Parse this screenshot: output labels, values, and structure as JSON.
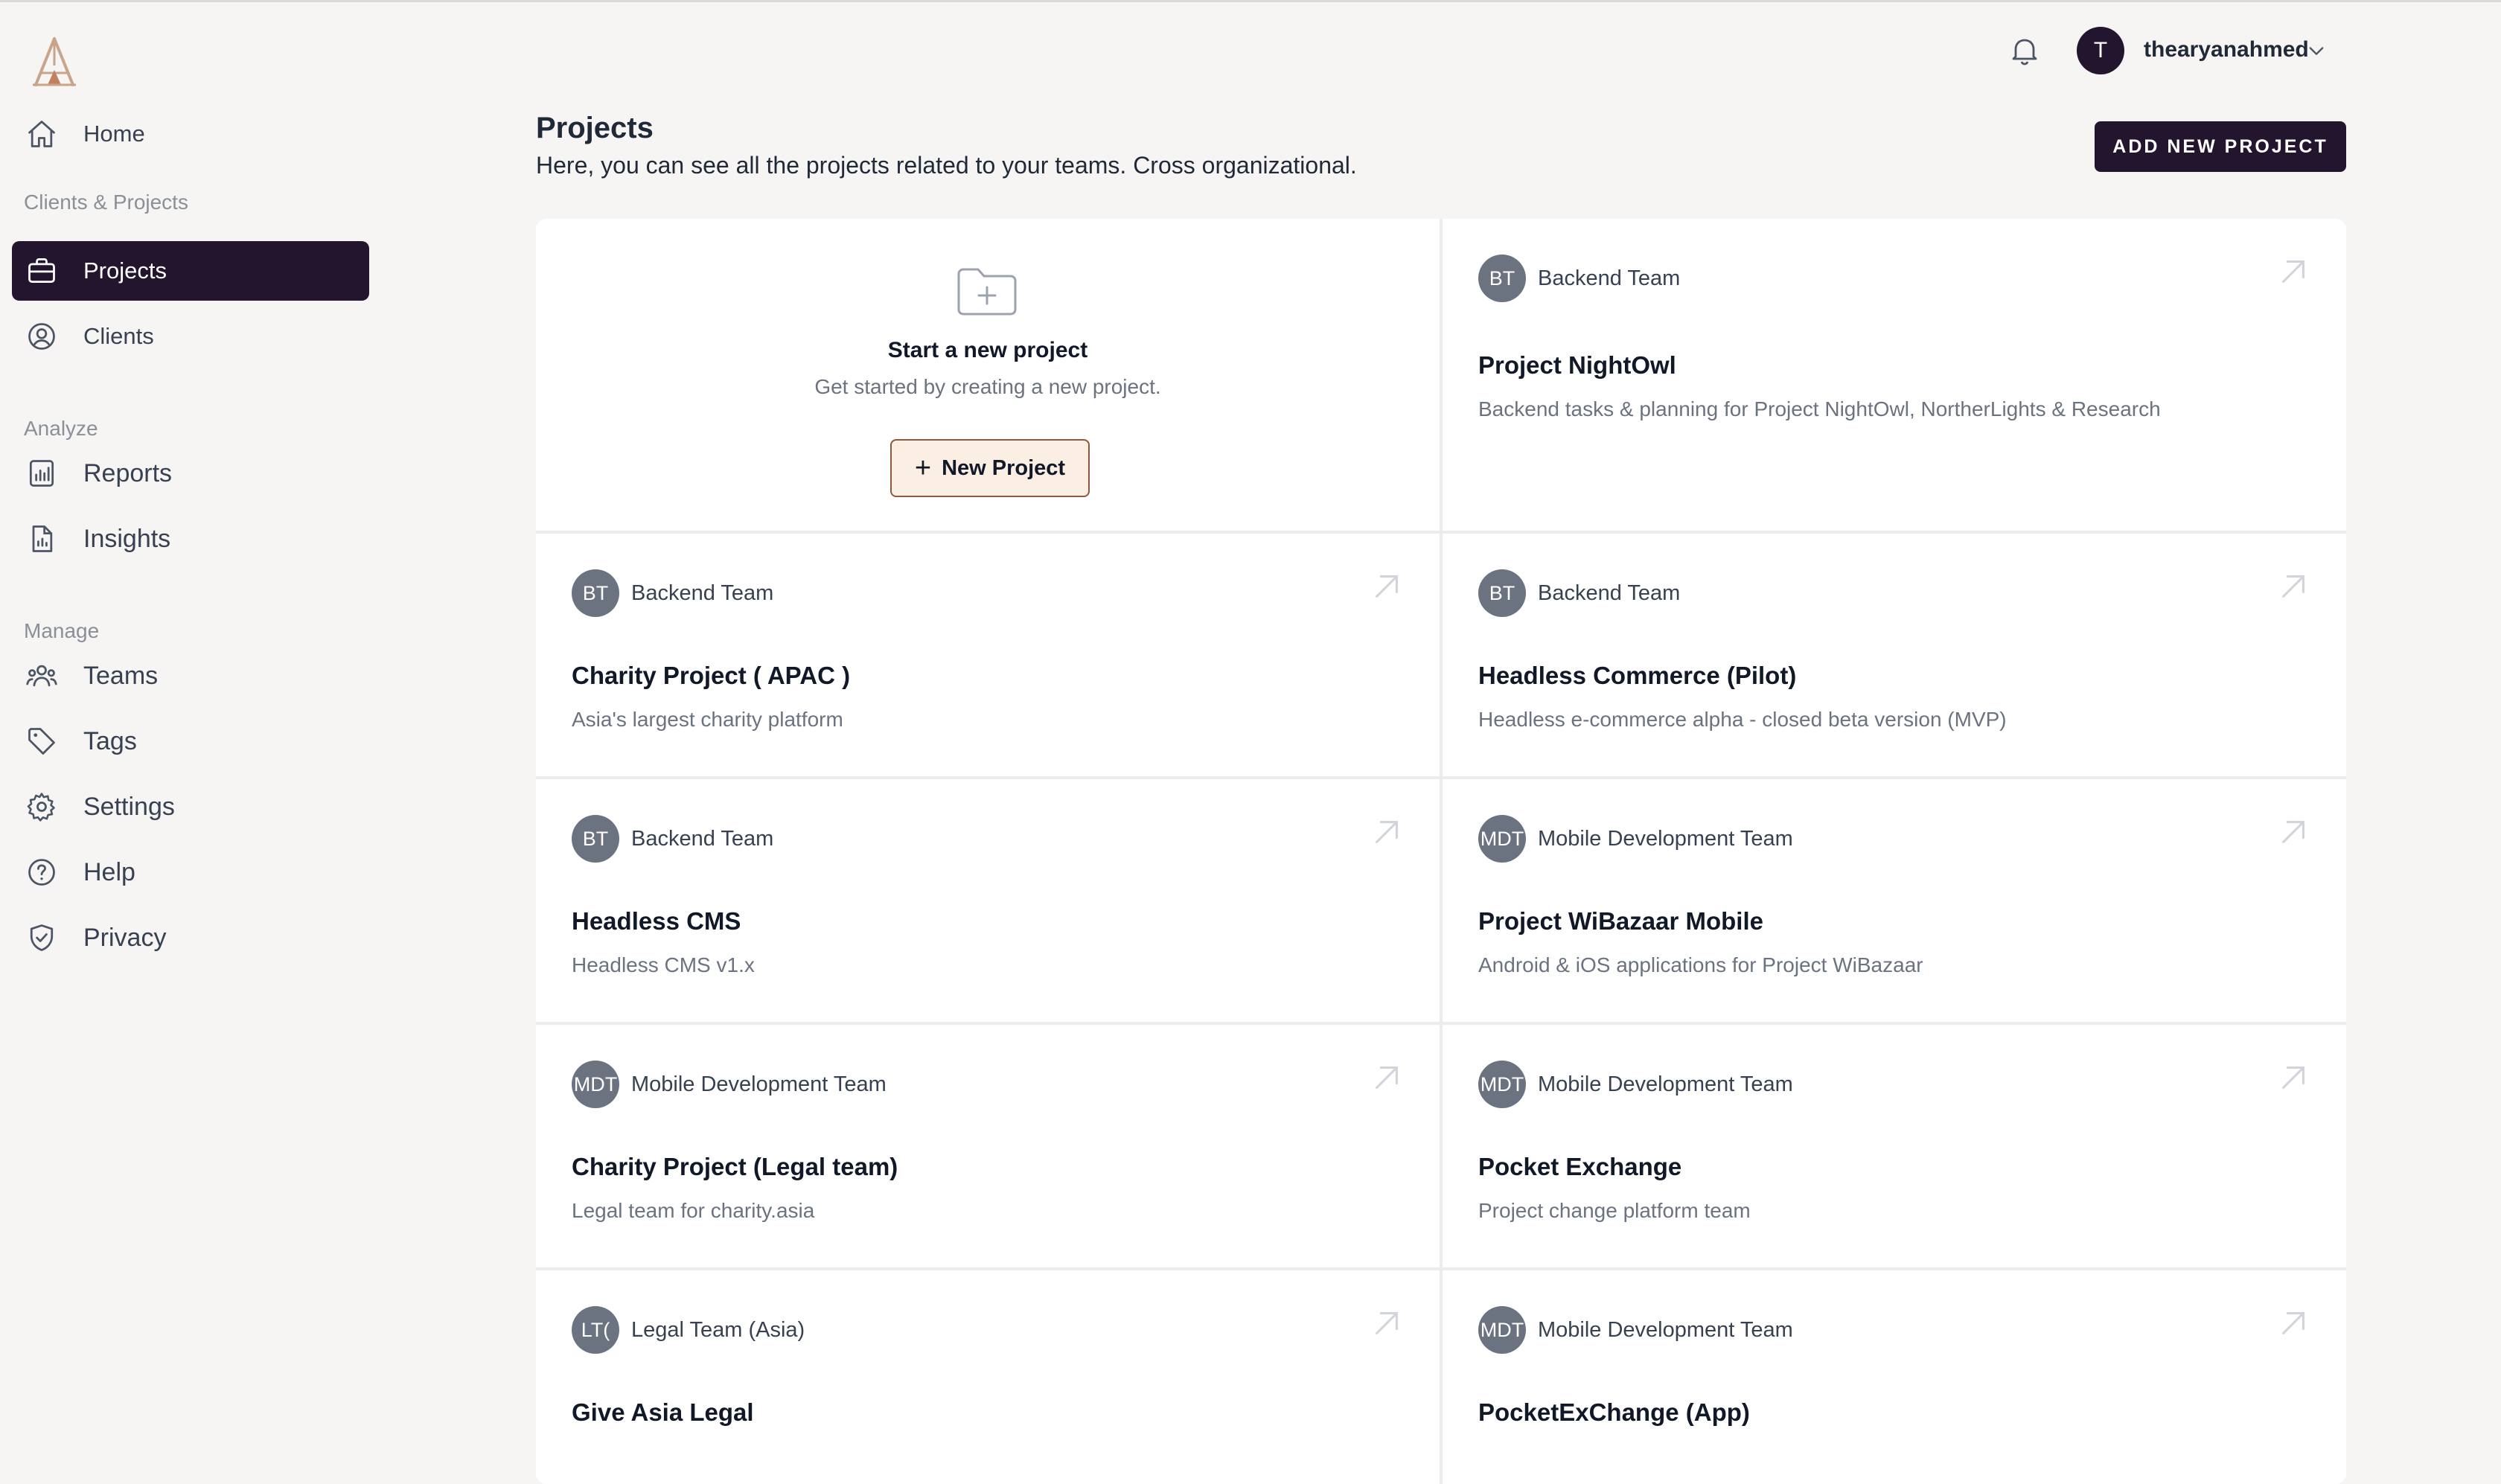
{
  "sidebar": {
    "logo": "triangle-logo",
    "home": "Home",
    "section_clients": "Clients & Projects",
    "projects": "Projects",
    "clients": "Clients",
    "section_analyze": "Analyze",
    "reports": "Reports",
    "insights": "Insights",
    "section_manage": "Manage",
    "teams": "Teams",
    "tags": "Tags",
    "settings": "Settings",
    "help": "Help",
    "privacy": "Privacy"
  },
  "header": {
    "user_initial": "T",
    "username": "thearyanahmed",
    "title": "Projects",
    "subtitle": "Here, you can see all the projects related to your teams. Cross organizational.",
    "add_button": "ADD NEW PROJECT"
  },
  "new_project": {
    "title": "Start a new project",
    "subtitle": "Get started by creating a new project.",
    "button": "New Project"
  },
  "projects": [
    {
      "initials": "BT",
      "team": "Backend Team",
      "name": "Project NightOwl",
      "description": "Backend tasks & planning for Project NightOwl, NortherLights & Research"
    },
    {
      "initials": "BT",
      "team": "Backend Team",
      "name": "Charity Project ( APAC )",
      "description": "Asia's largest charity platform"
    },
    {
      "initials": "BT",
      "team": "Backend Team",
      "name": "Headless Commerce (Pilot)",
      "description": "Headless e-commerce alpha - closed beta version (MVP)"
    },
    {
      "initials": "BT",
      "team": "Backend Team",
      "name": "Headless CMS",
      "description": "Headless CMS v1.x"
    },
    {
      "initials": "MDT",
      "team": "Mobile Development Team",
      "name": "Project WiBazaar Mobile",
      "description": "Android & iOS applications for Project WiBazaar"
    },
    {
      "initials": "MDT",
      "team": "Mobile Development Team",
      "name": "Charity Project (Legal team)",
      "description": "Legal team for charity.asia"
    },
    {
      "initials": "MDT",
      "team": "Mobile Development Team",
      "name": "Pocket Exchange",
      "description": "Project change platform team"
    },
    {
      "initials": "LT(",
      "team": "Legal Team (Asia)",
      "name": "Give Asia Legal",
      "description": ""
    },
    {
      "initials": "MDT",
      "team": "Mobile Development Team",
      "name": "PocketExChange (App)",
      "description": ""
    }
  ],
  "colors": {
    "accent": "#24152e",
    "new_button_bg": "#fbeee3",
    "new_button_border": "#8b5a3c",
    "team_avatar": "#6b7280",
    "background": "#f6f5f3"
  }
}
